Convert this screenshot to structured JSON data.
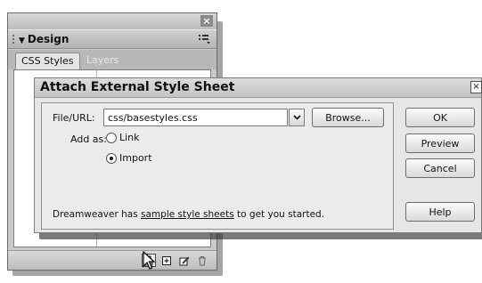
{
  "panel": {
    "title": "Design",
    "tabs": [
      "CSS Styles",
      "Layers"
    ]
  },
  "dialog": {
    "title": "Attach External Style Sheet",
    "file_label": "File/URL:",
    "file_value": "css/basestyles.css",
    "browse_label": "Browse...",
    "add_as_label": "Add as:",
    "options": [
      {
        "label": "Link",
        "selected": false
      },
      {
        "label": "Import",
        "selected": true
      }
    ],
    "help_text_before": "Dreamweaver has ",
    "help_link": "sample style sheets",
    "help_text_after": " to get you started.",
    "buttons": {
      "ok": "OK",
      "preview": "Preview",
      "cancel": "Cancel",
      "help": "Help"
    }
  },
  "icons": {
    "panel_close": "close-icon",
    "collapse": "triangle-down-icon",
    "panel_options": "options-menu-icon",
    "dropdown": "chevron-down-icon",
    "attach": "attach-style-sheet-icon",
    "new_rule": "new-css-rule-icon",
    "edit": "edit-style-icon",
    "trash": "trash-icon",
    "cursor": "mouse-pointer-icon"
  }
}
